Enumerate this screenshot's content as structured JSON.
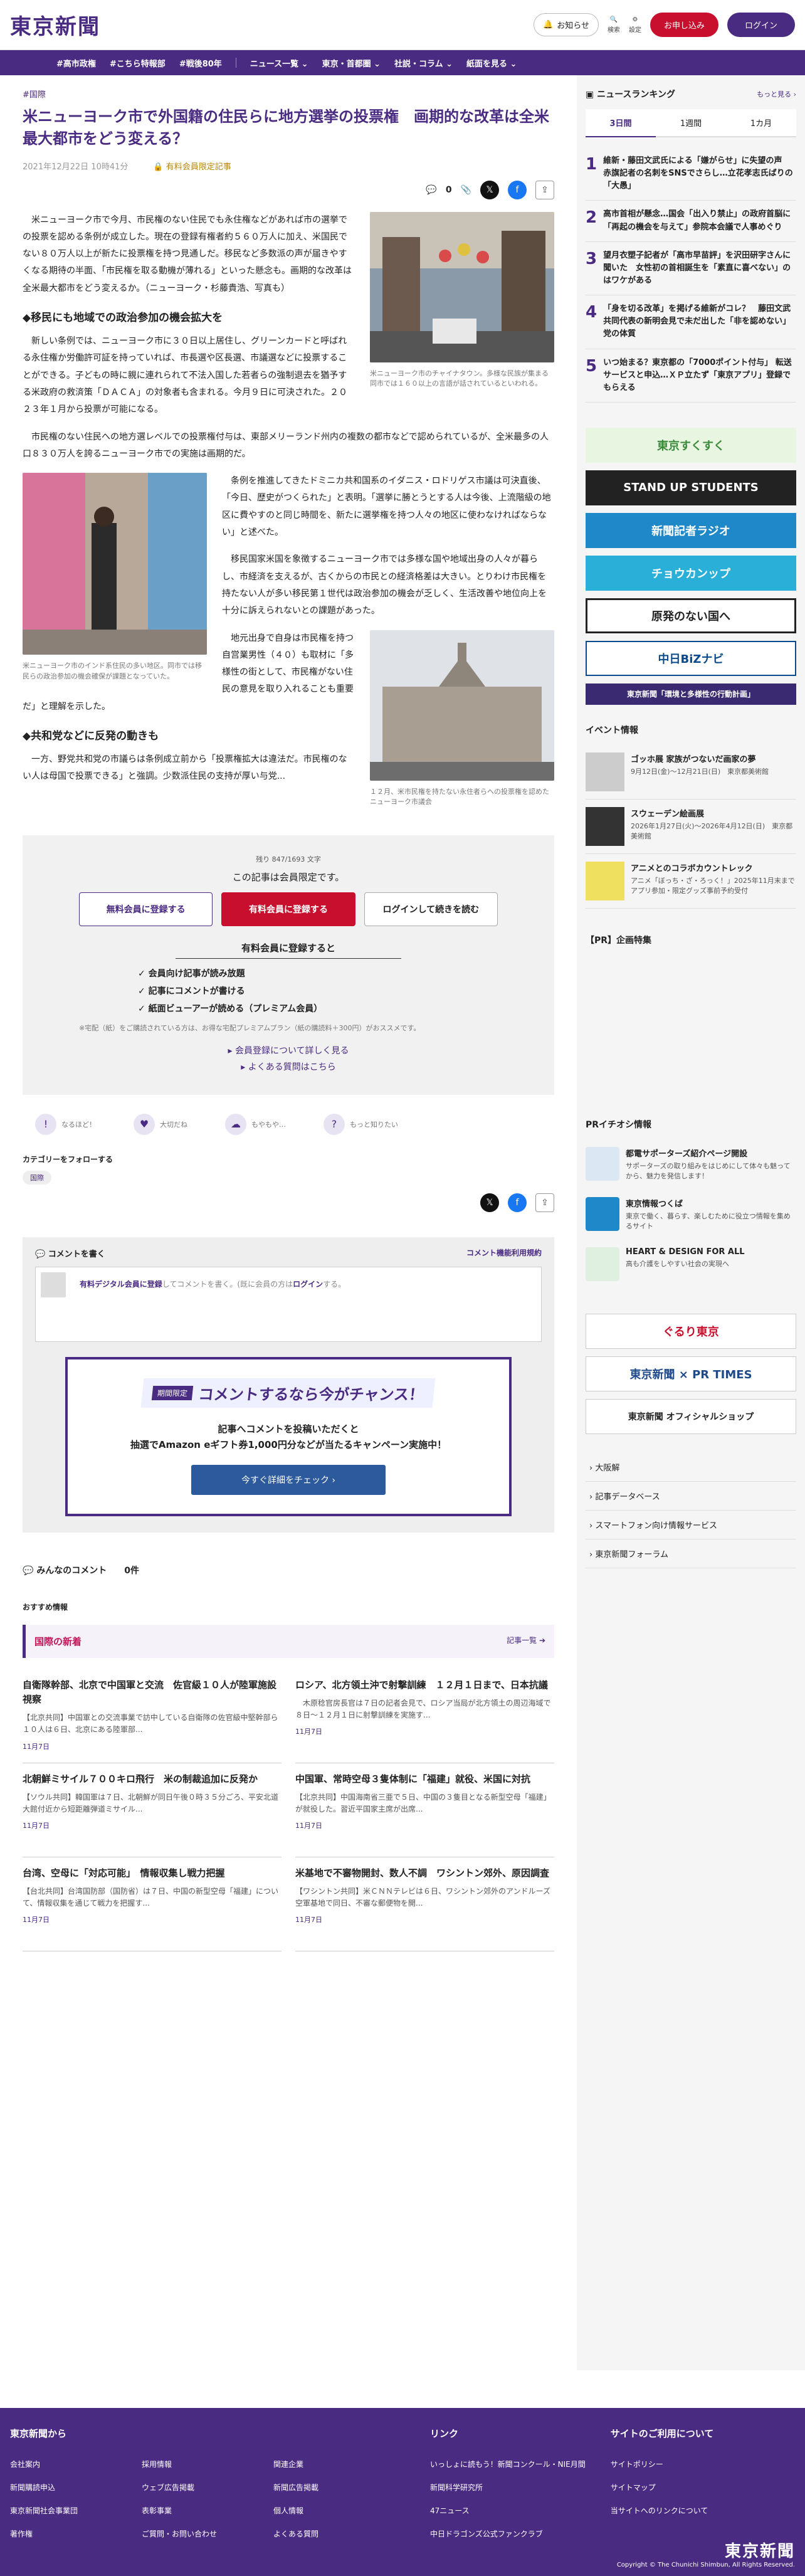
{
  "header": {
    "logo": "東京新聞",
    "notice": "お知らせ",
    "search": "検索",
    "settings": "設定",
    "signup": "お申し込み",
    "login": "ログイン"
  },
  "nav": [
    "#高市政権",
    "#こちら特報部",
    "#戦後80年",
    "ニュース一覧 ⌄",
    "東京・首都圏 ⌄",
    "社説・コラム ⌄",
    "紙面を見る ⌄"
  ],
  "article": {
    "tag": "#国際",
    "title": "米ニューヨーク市で外国籍の住民らに地方選挙の投票権　画期的な改革は全米最大都市をどう変える？",
    "date": "2021年12月22日 10時41分",
    "paid": "有料会員限定記事",
    "comment_count": "0",
    "paragraphs": [
      "米ニューヨーク市で今月、市民権のない住民でも永住権などがあれば市の選挙での投票を認める条例が成立した。現在の登録有権者約５６０万人に加え、米国民でない８０万人以上が新たに投票権を持つ見通しだ。移民など多数派の声が届きやすくなる期待の半面、「市民権を取る動機が薄れる」といった懸念も。画期的な改革は全米最大都市をどう変えるか。（ニューヨーク・杉藤貴浩、写真も）",
      "新しい条例では、ニューヨーク市に３０日以上居住し、グリーンカードと呼ばれる永住権か労働許可証を持っていれば、市長選や区長選、市議選などに投票することができる。子どもの時に親に連れられて不法入国した若者らの強制退去を猶予する米政府の救済策「ＤＡＣＡ」の対象者も含まれる。今月９日に可決された。２０２３年１月から投票が可能になる。",
      "市民権のない住民への地方選レベルでの投票権付与は、東部メリーランド州内の複数の都市などで認められているが、全米最多の人口８３０万人を誇るニューヨーク市での実施は画期的だ。",
      "条例を推進してきたドミニカ共和国系のイダニス・ロドリゲス市議は可決直後、「今日、歴史がつくられた」と表明。「選挙に勝とうとする人は今後、上流階級の地区に費やすのと同じ時間を、新たに選挙権を持つ人々の地区に使わなければならない」と述べた。",
      "移民国家米国を象徴するニューヨーク市では多様な国や地域出身の人々が暮らし、市経済を支えるが、古くからの市民との経済格差は大きい。とりわけ市民権を持たない人が多い移民第１世代は政治参加の機会が乏しく、生活改善や地位向上を十分に訴えられないとの課題があった。",
      "地元出身で自身は市民権を持つ自営業男性（４０）も取材に「多様性の街として、市民権がない住民の意見を取り入れることも重要だ」と理解を示した。",
      "一方、野党共和党の市議らは条例成立前から「投票権拡大は違法だ。市民権のない人は母国で投票できる」と強調。少数派住民の支持が厚い与党..."
    ],
    "h2_1": "◆移民にも地域での政治参加の機会拡大を",
    "h2_2": "◆共和党などに反発の動きも",
    "cap1": "米ニューヨーク市のチャイナタウン。多様な民族が集まる同市では１６０以上の言語が話されているといわれる。",
    "cap2": "米ニューヨーク市のインド系住民の多い地区。同市では移民らの政治参加の機会確保が課題となっていた。",
    "cap3": "１２月、米市民権を持たない永住者らへの投票権を認めたニューヨーク市議会"
  },
  "paywall": {
    "count": "残り 847/1693 文字",
    "title": "この記事は会員限定です。",
    "free": "無料会員に登録する",
    "paid": "有料会員に登録する",
    "login": "ログインして続きを読む",
    "sub": "有料会員に登録すると",
    "benefits": [
      "✓ 会員向け記事が読み放題",
      "✓ 記事にコメントが書ける",
      "✓ 紙面ビューアーが読める（プレミアム会員）"
    ],
    "note": "※宅配（紙）をご購読されている方は、お得な宅配プレミアムプラン（紙の購読料＋300円）がおススメです。",
    "link1": "▸ 会員登録について詳しく見る",
    "link2": "▸ よくある質問はこちら"
  },
  "reactions": [
    "なるほど！",
    "大切だね",
    "もやもや…",
    "もっと知りたい"
  ],
  "follow": {
    "title": "カテゴリーをフォローする",
    "chip": "国際"
  },
  "comments": {
    "title": "コメントを書く",
    "rules": "コメント機能利用規約",
    "placeholder_pre": "有料デジタル会員に登録",
    "placeholder_mid": "してコメントを書く。(既に会員の方は",
    "placeholder_login": "ログイン",
    "placeholder_post": "する。",
    "camp_tag": "期間限定",
    "camp_title": "コメントするなら今がチャンス！",
    "camp_text1": "記事へコメントを投稿いただくと",
    "camp_text2": "抽選でAmazon eギフト券1,000円分などが当たるキャンペーン実施中！",
    "camp_btn": "今すぐ詳細をチェック ›",
    "all": "みんなのコメント　　0件"
  },
  "reco": "おすすめ情報",
  "news": {
    "head": "国際の新着",
    "more": "記事一覧 ➔",
    "items": [
      {
        "title": "自衛隊幹部、北京で中国軍と交流　佐官級１０人が陸軍施設視察",
        "body": "【北京共同】中国軍との交流事業で訪中している自衛隊の佐官級中堅幹部ら１０人は６日、北京にある陸軍部...",
        "date": "11月7日"
      },
      {
        "title": "ロシア、北方領土沖で射撃訓練　１２月１日まで、日本抗議",
        "body": "　木原稔官房長官は７日の記者会見で、ロシア当局が北方領土の周辺海域で８日〜１２月１日に射撃訓練を実施す...",
        "date": "11月7日"
      },
      {
        "title": "北朝鮮ミサイル７００キロ飛行　米の制裁追加に反発か",
        "body": "【ソウル共同】韓国軍は７日、北朝鮮が同日午後０時３５分ごろ、平安北道大館付近から短距離弾道ミサイル...",
        "date": "11月7日"
      },
      {
        "title": "中国軍、常時空母３隻体制に「福建」就役、米国に対抗",
        "body": "【北京共同】中国海南省三亜で５日、中国の３隻目となる新型空母「福建」が就役した。習近平国家主席が出席...",
        "date": "11月7日"
      },
      {
        "title": "台湾、空母に「対応可能」　情報収集し戦力把握",
        "body": "【台北共同】台湾国防部（国防省）は７日、中国の新型空母「福建」について、情報収集を通じて戦力を把握す...",
        "date": "11月7日"
      },
      {
        "title": "米基地で不審物開封、数人不調　ワシントン郊外、原因調査",
        "body": "【ワシントン共同】米ＣＮＮテレビは６日、ワシントン郊外のアンドルーズ空軍基地で同日、不審な郵便物を開...",
        "date": "11月7日"
      }
    ]
  },
  "sidebar": {
    "rank_title": "ニュースランキング",
    "rank_more": "もっと見る ›",
    "tabs": [
      "3日間",
      "1週間",
      "1カ月"
    ],
    "ranks": [
      "維新・藤田文武氏による「嫌がらせ」に失望の声　赤旗記者の名刺をSNSでさらし…立花孝志氏ばりの「大愚」",
      "高市首相が懸念…国会「出入り禁止」の政府首脳に「再起の機会を与えて」参院本会議で人事めぐり",
      "望月衣塑子記者が「高市早苗評」を沢田研字さんに聞いた　女性初の首相誕生を「素直に喜べない」のはワケがある",
      "「身を切る改革」を掲げる維新がコレ？　藤田文武共同代表の新明会見で未だ出した「非を認めない」党の体質",
      "いつ始まる？東京都の「7000ポイント付与」 転送サービスと申込…ＸＰ立たず「東京アプリ」登録でもらえる"
    ],
    "banners": [
      "東京すくすく",
      "STAND UP STUDENTS",
      "新聞記者ラジオ",
      "チョウカンップ",
      "原発のない国へ",
      "中日BiZナビ",
      "東京新聞「環境と多様性の行動計画」"
    ],
    "events_title": "イベント情報",
    "events": [
      {
        "title": "ゴッホ展 家族がつないだ画家の夢",
        "desc": "9月12日(金)〜12月21日(日)　東京都美術館"
      },
      {
        "title": "スウェーデン絵画展",
        "desc": "2026年1月27日(火)〜2026年4月12日(日)　東京都美術館"
      },
      {
        "title": "アニメとのコラボカウントレック",
        "desc": "アニメ「ぼっち・ざ・ろっく！」2025年11月末までアプリ参加・限定グッズ事前予約受付"
      }
    ],
    "pr_title": "【PR】企画特集",
    "pr2_title": "PRイチオシ情報",
    "prs": [
      {
        "title": "都電サポーターズ紹介ページ開設",
        "desc": "サポーターズの取り組みをはじめにして体々も魅ってから、魅力を発信します！"
      },
      {
        "title": "東京情報つくば",
        "desc": "東京で働く、暮らす、楽しむために役立つ情報を集めるサイト"
      },
      {
        "title": "HEART & DESIGN FOR ALL",
        "desc": "高も介護をしやすい社会の実現へ"
      }
    ],
    "links": [
      "大阪解",
      "記事データベース",
      "スマートフォン向け情報サービス",
      "東京新聞フォーラム"
    ]
  },
  "footer": {
    "col1": "東京新聞から",
    "col1_items": [
      "会社案内",
      "採用情報",
      "関連企業",
      "新聞購読申込",
      "ウェブ広告掲載",
      "新聞広告掲載",
      "東京新聞社会事業団",
      "表彰事業",
      "個人情報",
      "著作権",
      "ご質問・お問い合わせ",
      "よくある質問"
    ],
    "col2": "リンク",
    "col2_items": [
      "いっしょに読もう！新聞コンクール・NIE月間",
      "新聞科学研究所",
      "47ニュース",
      "中日ドラゴンズ公式ファンクラブ"
    ],
    "col3": "サイトのご利用について",
    "col3_items": [
      "サイトポリシー",
      "サイトマップ",
      "当サイトへのリンクについて"
    ],
    "logo": "東京新聞",
    "copy": "Copyright © The Chunichi Shimbun, All Rights Reserved."
  }
}
